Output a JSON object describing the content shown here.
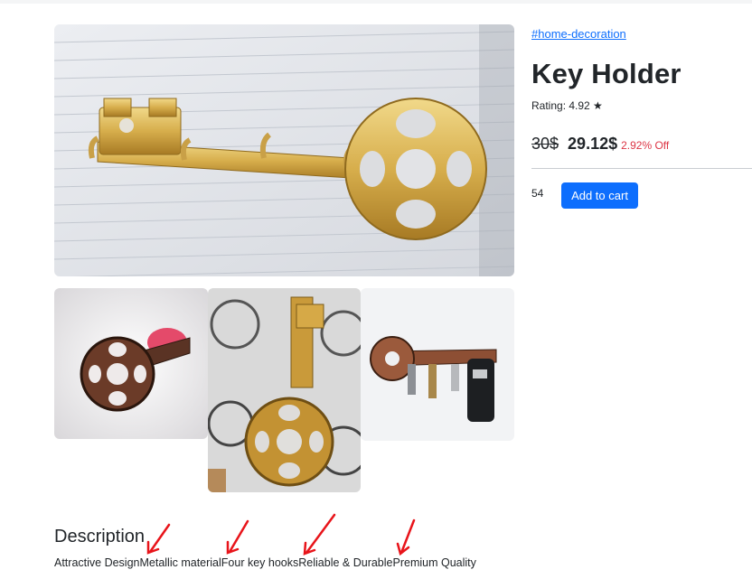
{
  "product": {
    "tag": "#home-decoration",
    "title": "Key Holder",
    "rating": "Rating: 4.92 ★",
    "old_price": "30$",
    "new_price": "29.12$",
    "discount": "2.92% Off",
    "stock": "54",
    "add_to_cart": "Add to cart"
  },
  "description": {
    "heading": "Description",
    "features": [
      "Attractive Design",
      "Metallic material",
      "Four key hooks",
      "Reliable & Durable",
      "Premium Quality"
    ]
  },
  "colors": {
    "accent": "#0d6efd",
    "discount": "#dc3545",
    "annotation_arrow": "#e8141a"
  }
}
